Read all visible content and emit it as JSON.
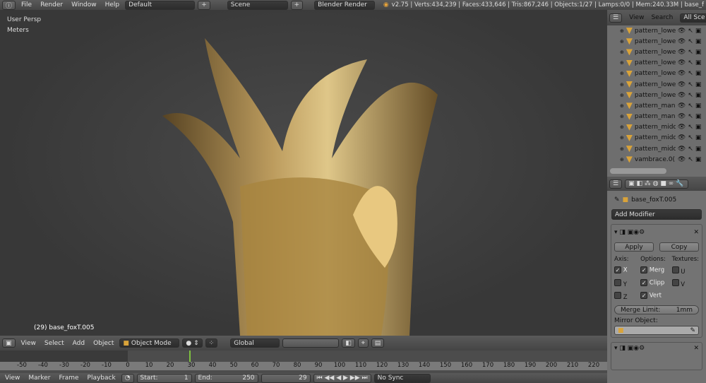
{
  "top": {
    "menus": [
      "File",
      "Render",
      "Window",
      "Help"
    ],
    "layout": "Default",
    "scene": "Scene",
    "engine": "Blender Render",
    "stats": "v2.75 | Verts:434,239 | Faces:433,646 | Tris:867,246 | Objects:1/27 | Lamps:0/0 | Mem:240.33M | base_f"
  },
  "viewport": {
    "view": "User Persp",
    "units": "Meters",
    "object_label": "(29) base_foxT.005"
  },
  "vhead": {
    "menus": [
      "View",
      "Select",
      "Add",
      "Object"
    ],
    "mode": "Object Mode",
    "orientation": "Global"
  },
  "timeline": {
    "ticks": [
      "-50",
      "-40",
      "-30",
      "-20",
      "-10",
      "0",
      "10",
      "20",
      "30",
      "40",
      "50",
      "60",
      "70",
      "80",
      "90",
      "100",
      "110",
      "120",
      "130",
      "140",
      "150",
      "160",
      "170",
      "180",
      "190",
      "200",
      "210",
      "220"
    ],
    "current_frame": 29
  },
  "tlhead": {
    "menus": [
      "View",
      "Marker",
      "Frame",
      "Playback"
    ],
    "start_label": "Start:",
    "start": "1",
    "end_label": "End:",
    "end": "250",
    "frame": "29",
    "sync": "No Sync"
  },
  "outliner": {
    "menus": [
      "View",
      "Search"
    ],
    "filter": "All Sce",
    "items": [
      "pattern_lowe",
      "pattern_lowe",
      "pattern_lowe",
      "pattern_lowe",
      "pattern_lowe",
      "pattern_lowe",
      "pattern_lowe",
      "pattern_man",
      "pattern_man",
      "pattern_midc",
      "pattern_midc",
      "pattern_midc",
      "vambrace.0("
    ]
  },
  "props": {
    "object": "base_foxT.005",
    "add_modifier": "Add Modifier",
    "apply": "Apply",
    "copy": "Copy",
    "axis": "Axis:",
    "options": "Options:",
    "textures": "Textures:",
    "x": "X",
    "y": "Y",
    "z": "Z",
    "merg": "Merg",
    "clipp": "Clipp",
    "vert": "Vert",
    "u": "U",
    "v": "V",
    "merge_limit_label": "Merge Limit:",
    "merge_limit": "1mm",
    "mirror_object": "Mirror Object:"
  }
}
